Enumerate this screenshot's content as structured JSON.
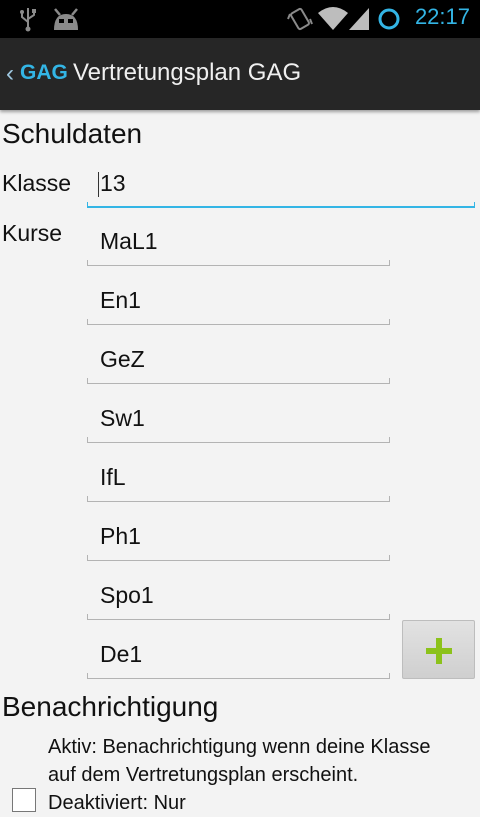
{
  "status_bar": {
    "time": "22:17"
  },
  "action_bar": {
    "logo": "GAG",
    "title": "Vertretungsplan GAG"
  },
  "school_section": {
    "heading": "Schuldaten",
    "class_label": "Klasse",
    "class_value": "13",
    "courses_label": "Kurse",
    "courses": [
      "MaL1",
      "En1",
      "GeZ",
      "Sw1",
      "IfL",
      "Ph1",
      "Spo1",
      "De1"
    ]
  },
  "notification_section": {
    "heading": "Benachrichtigung",
    "checkbox_text": "Aktiv: Benachrichtigung wenn deine Klasse auf dem Vertretungsplan erscheint. Deaktiviert: Nur",
    "checked": false
  },
  "colors": {
    "accent": "#33b5e5",
    "add_icon": "#8cc21b",
    "action_bar": "#262626"
  },
  "icons": [
    "usb-icon",
    "android-debug-icon",
    "vibrate-icon",
    "wifi-icon",
    "signal-icon",
    "sync-icon",
    "up-arrow-icon",
    "plus-icon"
  ]
}
